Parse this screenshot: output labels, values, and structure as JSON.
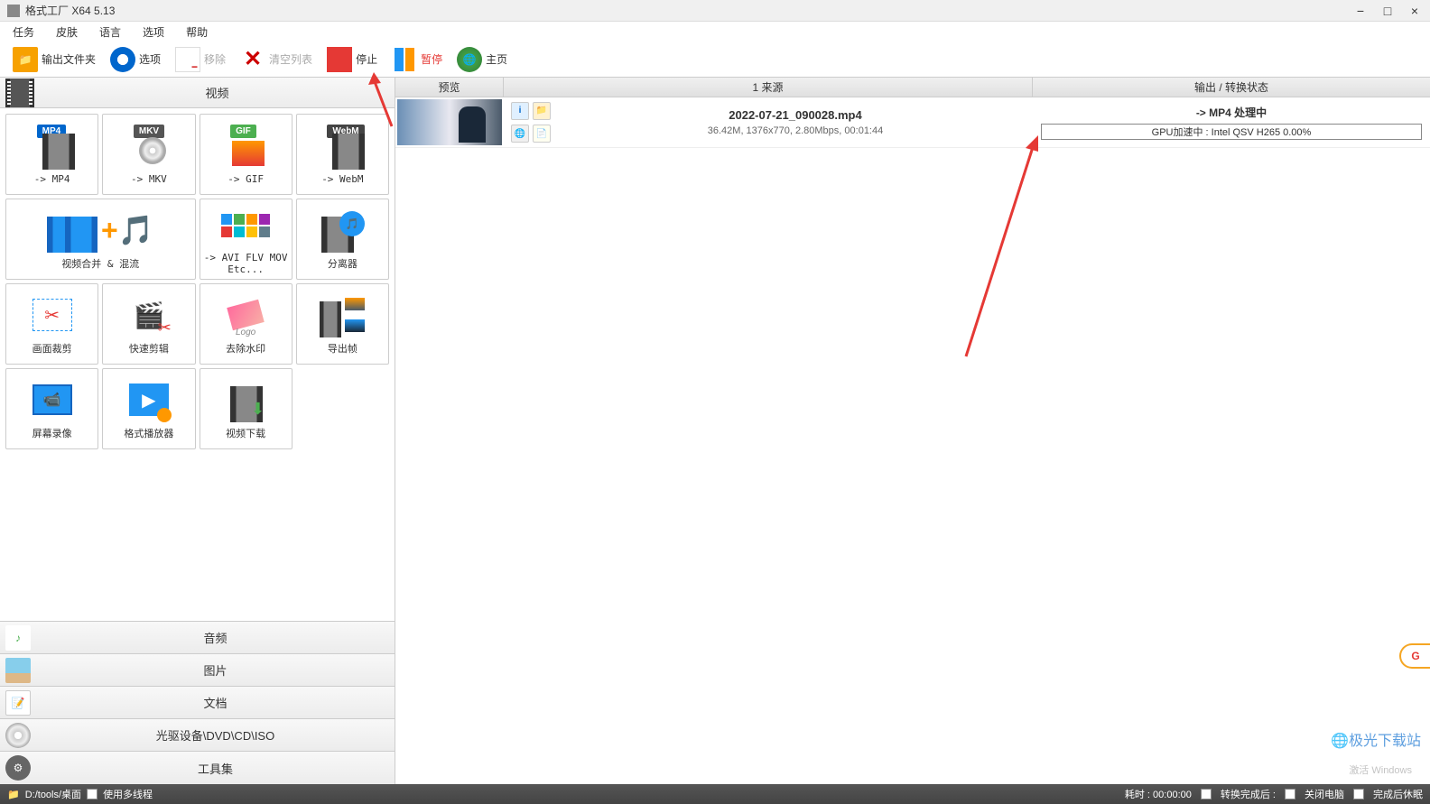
{
  "window": {
    "title": "格式工厂 X64 5.13"
  },
  "menubar": {
    "items": [
      "任务",
      "皮肤",
      "语言",
      "选项",
      "帮助"
    ]
  },
  "toolbar": {
    "output_folder": "输出文件夹",
    "options": "选项",
    "remove": "移除",
    "clear_list": "清空列表",
    "stop": "停止",
    "pause": "暂停",
    "home": "主页"
  },
  "sidebar": {
    "video_header": "视频",
    "formats": [
      {
        "label": "-> MP4",
        "type": "mp4"
      },
      {
        "label": "-> MKV",
        "type": "mkv"
      },
      {
        "label": "-> GIF",
        "type": "gif"
      },
      {
        "label": "-> WebM",
        "type": "webm"
      },
      {
        "label": "视频合并 & 混流",
        "type": "merge",
        "wide": true
      },
      {
        "label": "-> AVI FLV MOV Etc...",
        "type": "avi"
      },
      {
        "label": "分离器",
        "type": "split"
      },
      {
        "label": "画面裁剪",
        "type": "crop"
      },
      {
        "label": "快速剪辑",
        "type": "edit"
      },
      {
        "label": "去除水印",
        "type": "watermark"
      },
      {
        "label": "导出帧",
        "type": "frames"
      },
      {
        "label": "屏幕录像",
        "type": "record"
      },
      {
        "label": "格式播放器",
        "type": "player"
      },
      {
        "label": "视频下载",
        "type": "download"
      }
    ],
    "categories": [
      {
        "label": "音频",
        "icon": "audio"
      },
      {
        "label": "图片",
        "icon": "image"
      },
      {
        "label": "文档",
        "icon": "document"
      },
      {
        "label": "光驱设备\\DVD\\CD\\ISO",
        "icon": "disc"
      },
      {
        "label": "工具集",
        "icon": "tools"
      }
    ]
  },
  "content": {
    "columns": {
      "preview": "预览",
      "source": "1 来源",
      "status": "输出 / 转换状态"
    },
    "task": {
      "filename": "2022-07-21_090028.mp4",
      "details": "36.42M, 1376x770, 2.80Mbps, 00:01:44",
      "status_label": "-> MP4 处理中",
      "progress_text": "GPU加速中 : Intel QSV H265 0.00%"
    }
  },
  "statusbar": {
    "path": "D:/tools/桌面",
    "multithread": "使用多线程",
    "elapsed": "耗时 : 00:00:00",
    "opt1": "转换完成后 : ",
    "opt2": "关闭电脑",
    "opt3": "完成后休眠"
  },
  "watermark": {
    "activate": "激活 Windows",
    "logo": "极光下载站"
  },
  "bubble": "G"
}
